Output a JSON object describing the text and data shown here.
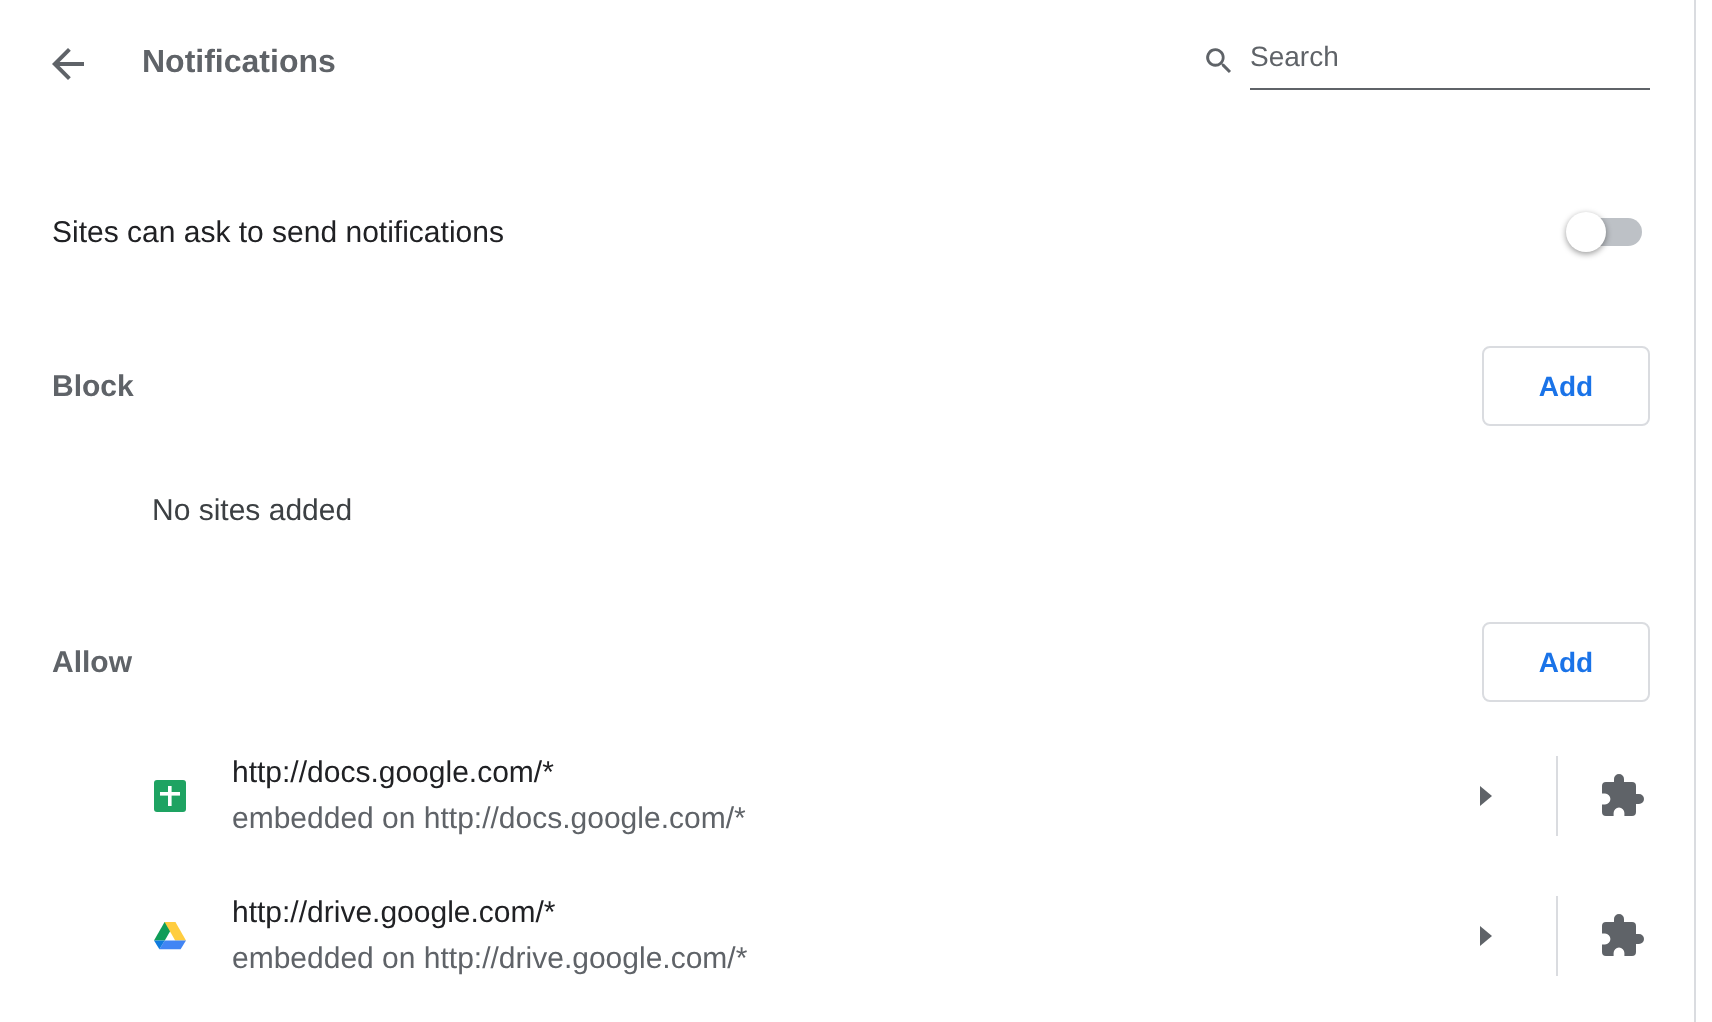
{
  "header": {
    "title": "Notifications",
    "search": {
      "placeholder": "Search"
    }
  },
  "setting": {
    "label": "Sites can ask to send notifications",
    "on": false
  },
  "sections": [
    {
      "title": "Block",
      "button": "Add",
      "empty_text": "No sites added"
    },
    {
      "title": "Allow",
      "button": "Add",
      "sites": [
        {
          "kind": "sheets",
          "url": "http://docs.google.com/*",
          "detail": "embedded on http://docs.google.com/*"
        },
        {
          "kind": "drive",
          "url": "http://drive.google.com/*",
          "detail": "embedded on http://drive.google.com/*"
        }
      ]
    }
  ]
}
